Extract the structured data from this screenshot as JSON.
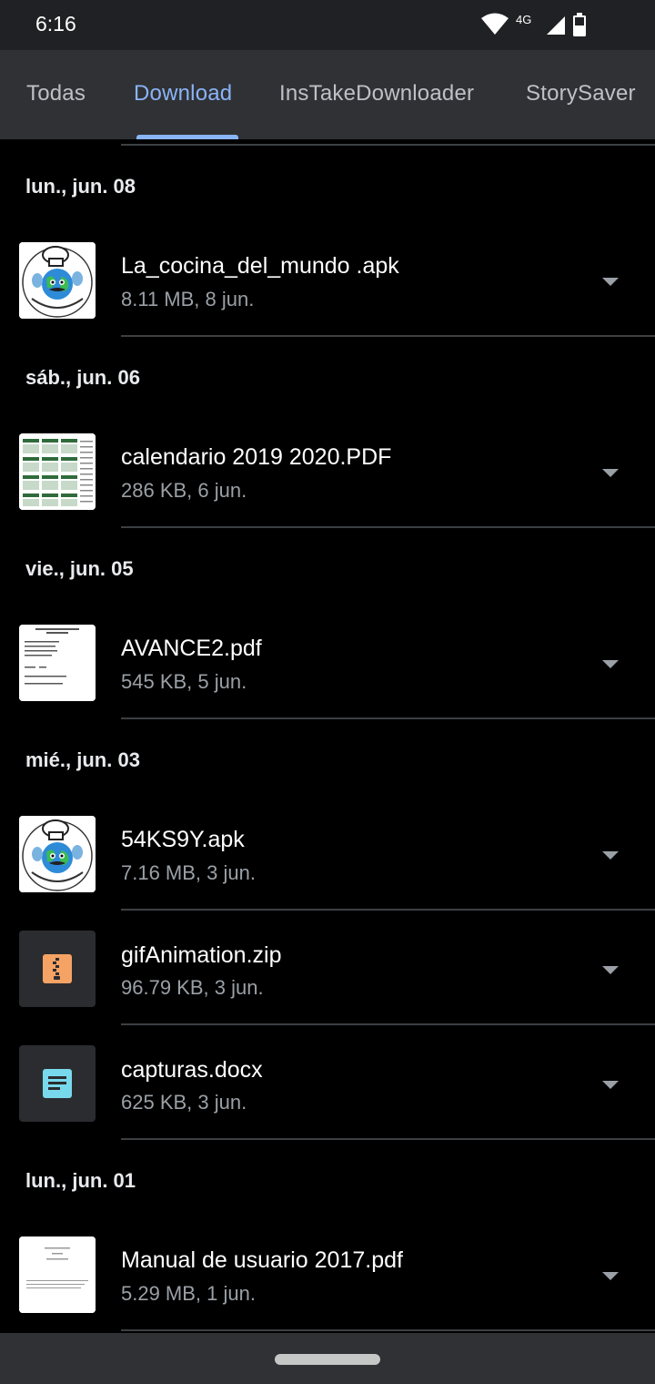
{
  "status_bar": {
    "time": "6:16",
    "network_label": "4G",
    "icons": [
      "wifi-icon",
      "cell-signal-icon",
      "battery-icon"
    ]
  },
  "tabs": [
    {
      "label": "Todas",
      "active": false
    },
    {
      "label": "Download",
      "active": true
    },
    {
      "label": "InsTakeDownloader",
      "active": false
    },
    {
      "label": "StorySaver",
      "active": false
    }
  ],
  "colors": {
    "accent": "#8ab4f8",
    "zip_icon": "#f5a365",
    "doc_icon": "#78d9ec"
  },
  "groups": [
    {
      "date": "lun., jun. 08",
      "files": [
        {
          "name": "La_cocina_del_mundo .apk",
          "meta": "8.11 MB, 8 jun.",
          "thumb": "cocina-logo"
        }
      ]
    },
    {
      "date": "sáb., jun. 06",
      "files": [
        {
          "name": "calendario 2019 2020.PDF",
          "meta": "286 KB, 6 jun.",
          "thumb": "calendar-pdf"
        }
      ]
    },
    {
      "date": "vie., jun. 05",
      "files": [
        {
          "name": "AVANCE2.pdf",
          "meta": "545 KB, 5 jun.",
          "thumb": "document-pdf"
        }
      ]
    },
    {
      "date": "mié., jun. 03",
      "files": [
        {
          "name": "54KS9Y.apk",
          "meta": "7.16 MB, 3 jun.",
          "thumb": "cocina-logo"
        },
        {
          "name": "gifAnimation.zip",
          "meta": "96.79 KB, 3 jun.",
          "thumb": "zip-icon"
        },
        {
          "name": "capturas.docx",
          "meta": "625 KB, 3 jun.",
          "thumb": "doc-icon"
        }
      ]
    },
    {
      "date": "lun., jun. 01",
      "files": [
        {
          "name": "Manual de usuario 2017.pdf",
          "meta": "5.29 MB, 1 jun.",
          "thumb": "manual-pdf"
        }
      ]
    }
  ]
}
